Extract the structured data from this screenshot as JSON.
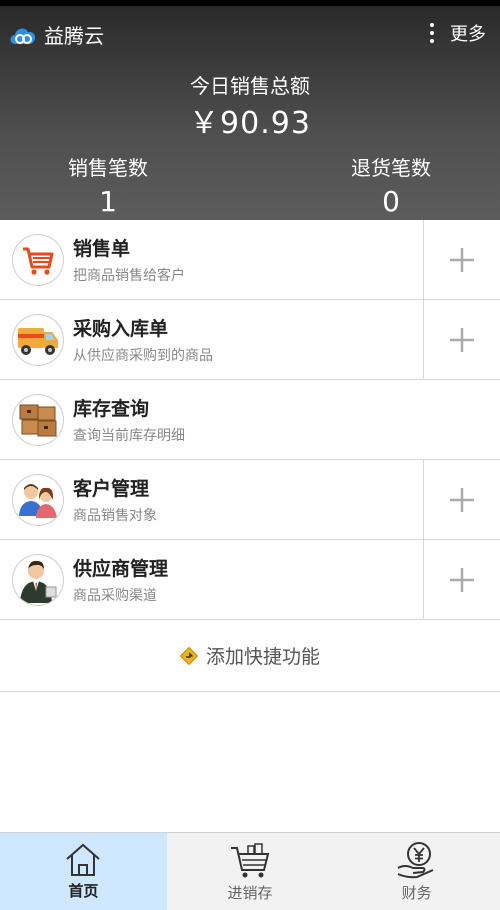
{
  "app": {
    "name": "益腾云",
    "more_label": "更多"
  },
  "summary": {
    "today_title": "今日销售总额",
    "today_value": "￥90.93",
    "sales_count_label": "销售笔数",
    "sales_count": "1",
    "returns_count_label": "退货笔数",
    "returns_count": "0"
  },
  "items": [
    {
      "title": "销售单",
      "sub": "把商品销售给客户",
      "icon": "shopping-cart-icon",
      "has_add": true
    },
    {
      "title": "采购入库单",
      "sub": "从供应商采购到的商品",
      "icon": "delivery-truck-icon",
      "has_add": true
    },
    {
      "title": "库存查询",
      "sub": "查询当前库存明细",
      "icon": "boxes-icon",
      "has_add": false
    },
    {
      "title": "客户管理",
      "sub": "商品销售对象",
      "icon": "customers-icon",
      "has_add": true
    },
    {
      "title": "供应商管理",
      "sub": "商品采购渠道",
      "icon": "supplier-icon",
      "has_add": true
    }
  ],
  "quick_add_label": "添加快捷功能",
  "tabs": [
    {
      "label": "首页",
      "icon": "home-icon",
      "active": true
    },
    {
      "label": "进销存",
      "icon": "cart-icon",
      "active": false
    },
    {
      "label": "财务",
      "icon": "yen-hand-icon",
      "active": false
    }
  ]
}
